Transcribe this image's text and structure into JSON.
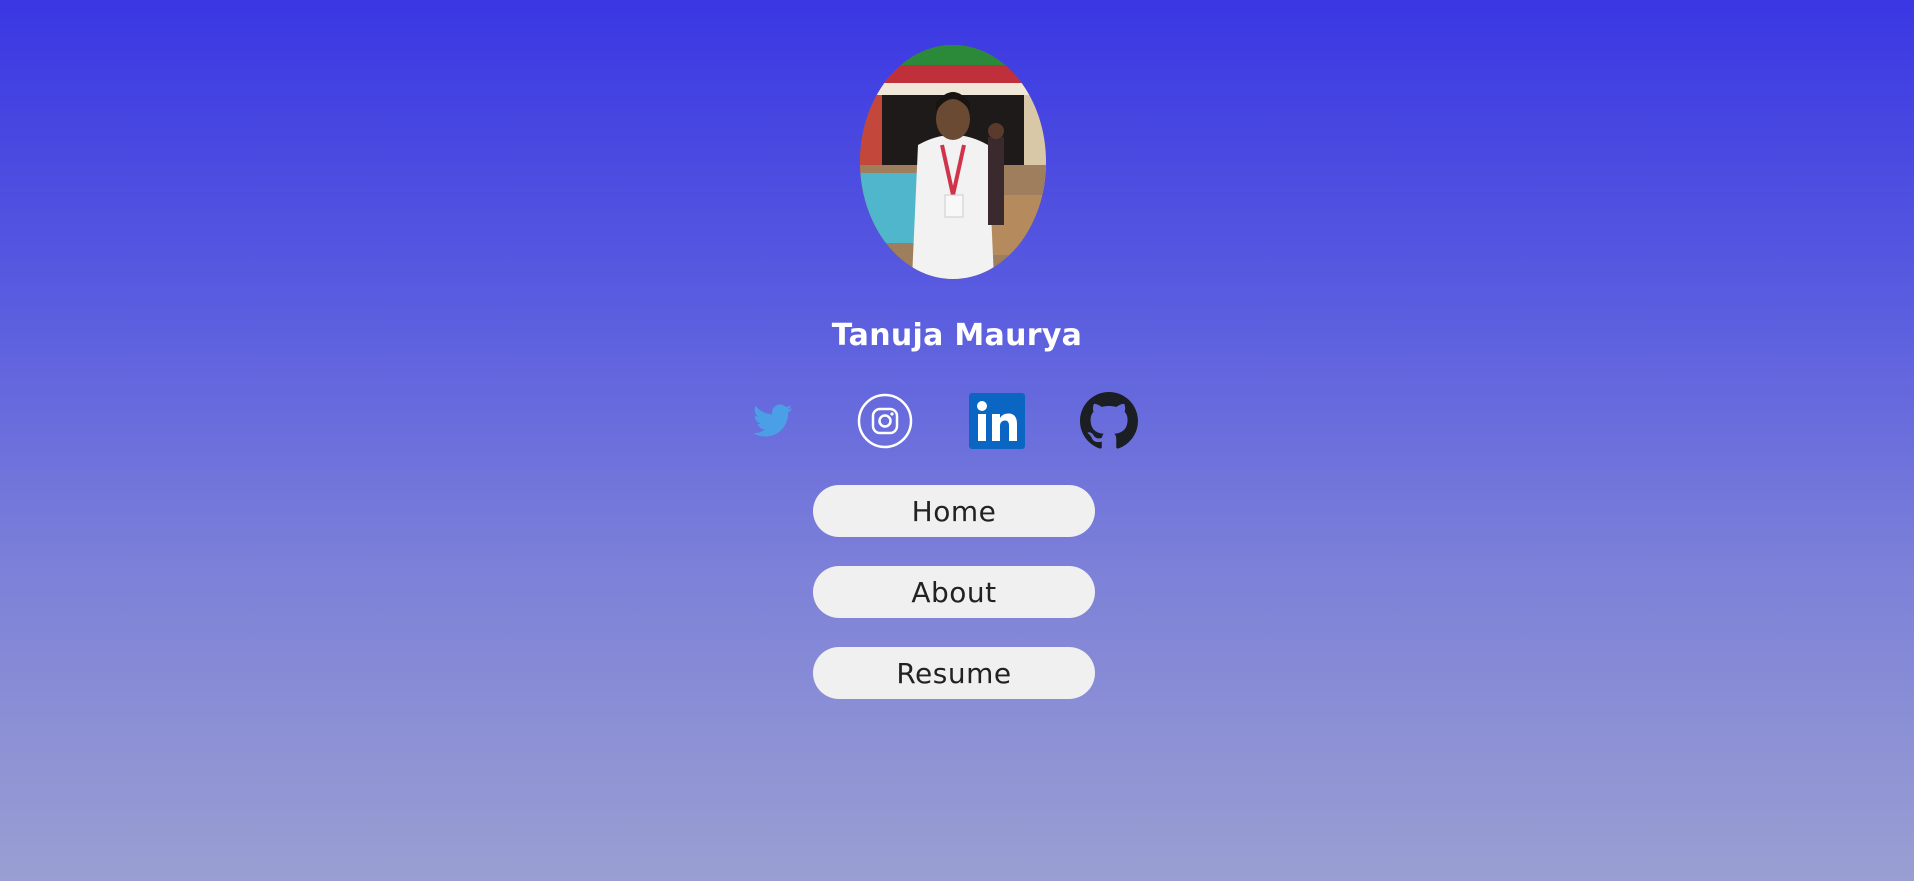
{
  "profile": {
    "name": "Tanuja Maurya",
    "avatar_alt": "profile photo"
  },
  "social": [
    {
      "icon": "twitter-icon",
      "color": "#4a9fe6"
    },
    {
      "icon": "instagram-icon",
      "color": "#ffffff"
    },
    {
      "icon": "linkedin-icon",
      "color": "#0a66c2"
    },
    {
      "icon": "github-icon",
      "color": "#1b1f23"
    }
  ],
  "nav": {
    "home_label": "Home",
    "about_label": "About",
    "resume_label": "Resume"
  },
  "colors": {
    "background_top": "#3a37e3",
    "background_bottom": "#9a9fd2",
    "button_bg": "#f0f0f0",
    "button_text": "#222222"
  }
}
